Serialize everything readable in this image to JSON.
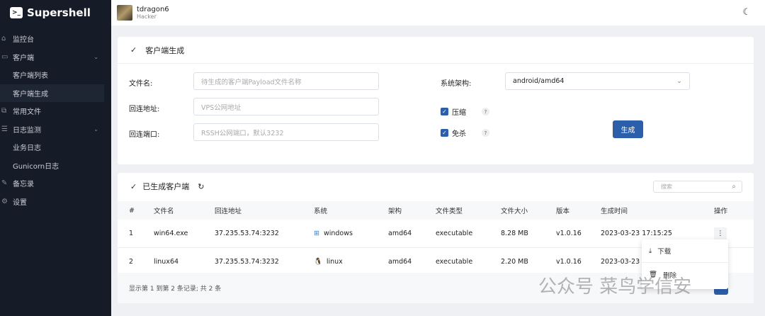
{
  "app": {
    "name": "Supershell",
    "logo_glyph": ">_"
  },
  "sidebar": {
    "items": [
      {
        "label": "监控台",
        "icon": "home-icon"
      },
      {
        "label": "客户端",
        "icon": "monitor-icon",
        "expandable": true
      },
      {
        "label": "客户端列表",
        "sub": true
      },
      {
        "label": "客户端生成",
        "sub": true,
        "active": true
      },
      {
        "label": "常用文件",
        "icon": "files-icon"
      },
      {
        "label": "日志监测",
        "icon": "log-icon",
        "expandable": true
      },
      {
        "label": "业务日志",
        "sub": true
      },
      {
        "label": "Gunicorn日志",
        "sub": true
      },
      {
        "label": "备忘录",
        "icon": "pen-icon"
      },
      {
        "label": "设置",
        "icon": "gear-icon"
      }
    ]
  },
  "header": {
    "username": "tdragon6",
    "role": "Hacker"
  },
  "generate": {
    "title": "客户端生成",
    "filename_label": "文件名:",
    "filename_placeholder": "待生成的客户端Payload文件名称",
    "address_label": "回连地址:",
    "address_placeholder": "VPS公网地址",
    "port_label": "回连端口:",
    "port_placeholder": "RSSH公网端口，默认3232",
    "arch_label": "系统架构:",
    "arch_value": "android/amd64",
    "compress_label": "压缩",
    "compress_checked": true,
    "avoid_label": "免杀",
    "avoid_checked": true,
    "help": "?",
    "generate_button": "生成"
  },
  "clients": {
    "title": "已生成客户端",
    "search_placeholder": "搜索",
    "columns": [
      "#",
      "文件名",
      "回连地址",
      "系统",
      "架构",
      "文件类型",
      "文件大小",
      "版本",
      "生成时间",
      "操作"
    ],
    "rows": [
      {
        "n": "1",
        "file": "win64.exe",
        "addr": "37.235.53.74:3232",
        "os": "windows",
        "os_icon": "windows-icon",
        "arch": "amd64",
        "type": "executable",
        "size": "8.28 MB",
        "ver": "v1.0.16",
        "time": "2023-03-23 17:15:25"
      },
      {
        "n": "2",
        "file": "linux64",
        "addr": "37.235.53.74:3232",
        "os": "linux",
        "os_icon": "linux-icon",
        "arch": "amd64",
        "type": "executable",
        "size": "2.20 MB",
        "ver": "v1.0.16",
        "time": "2023-03-23"
      }
    ],
    "footer": "显示第 1 到第 2 条记录; 共 2 条",
    "menu": {
      "download": "下载",
      "delete": "删除"
    }
  },
  "watermark": "公众号 菜鸟学信安",
  "colors": {
    "sidebar": "#151b27",
    "primary": "#2b5eab"
  }
}
